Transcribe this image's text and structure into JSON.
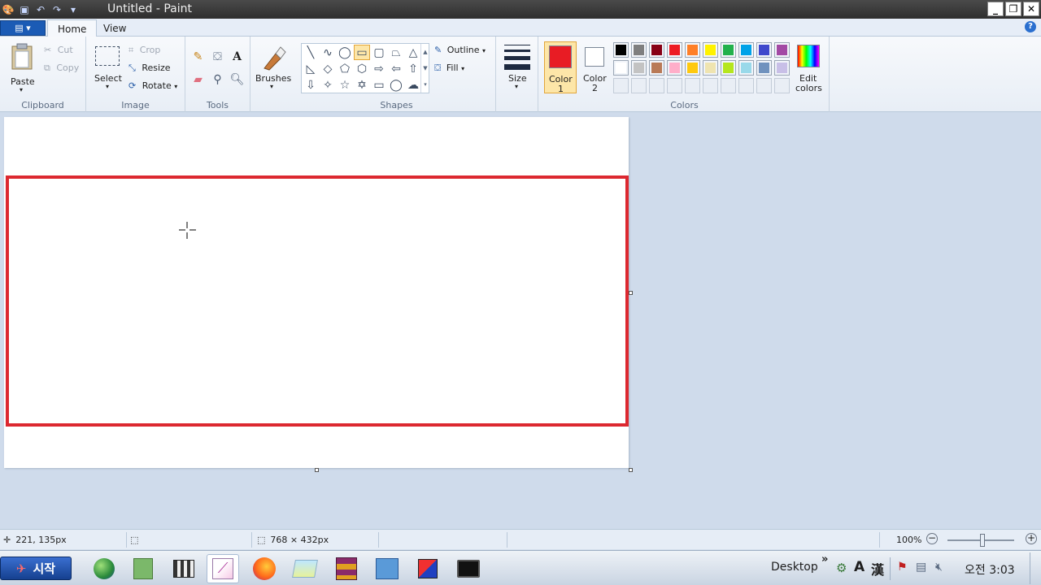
{
  "window": {
    "title": "Untitled - Paint",
    "minimize_label": "_",
    "restore_label": "❐",
    "close_label": "✕"
  },
  "quick_access": [
    "app-menu-icon",
    "save-icon",
    "undo-icon",
    "redo-icon",
    "customize-icon"
  ],
  "tabs": {
    "file_menu": "▤ ▾",
    "home": "Home",
    "view": "View",
    "help": "?"
  },
  "ribbon": {
    "clipboard": {
      "paste": "Paste",
      "cut": "Cut",
      "copy": "Copy",
      "label": "Clipboard"
    },
    "image": {
      "select": "Select",
      "crop": "Crop",
      "resize": "Resize",
      "rotate": "Rotate",
      "label": "Image"
    },
    "tools": {
      "label": "Tools"
    },
    "brushes": {
      "label": "Brushes"
    },
    "shapes": {
      "outline": "Outline",
      "fill": "Fill",
      "label": "Shapes"
    },
    "size": {
      "label": "Size"
    },
    "colors": {
      "color1_label": "Color",
      "color1_num": "1",
      "color2_label": "Color",
      "color2_num": "2",
      "edit_colors": "Edit",
      "edit_colors_2": "colors",
      "label": "Colors",
      "color1": "#e81c24",
      "color2": "#ffffff",
      "palette_row1": [
        "#000000",
        "#7f7f7f",
        "#880015",
        "#ed1c24",
        "#ff7f27",
        "#fff200",
        "#22b14c",
        "#00a2e8",
        "#3f48cc",
        "#a349a4"
      ],
      "palette_row2": [
        "#ffffff",
        "#c3c3c3",
        "#b97a57",
        "#ffaec9",
        "#ffc90e",
        "#efe4b0",
        "#b5e61d",
        "#99d9ea",
        "#7092be",
        "#c8bfe7"
      ]
    }
  },
  "canvas": {
    "rectangle_color": "#dc2830"
  },
  "status": {
    "cursor_pos": "221, 135px",
    "selection_size": "",
    "canvas_size": "768 × 432px",
    "zoom": "100%"
  },
  "taskbar": {
    "start": "시작",
    "desktop": "Desktop",
    "chevron": "»",
    "ime_a": "A",
    "ime_han": "漢",
    "clock": "오전 3:03"
  }
}
